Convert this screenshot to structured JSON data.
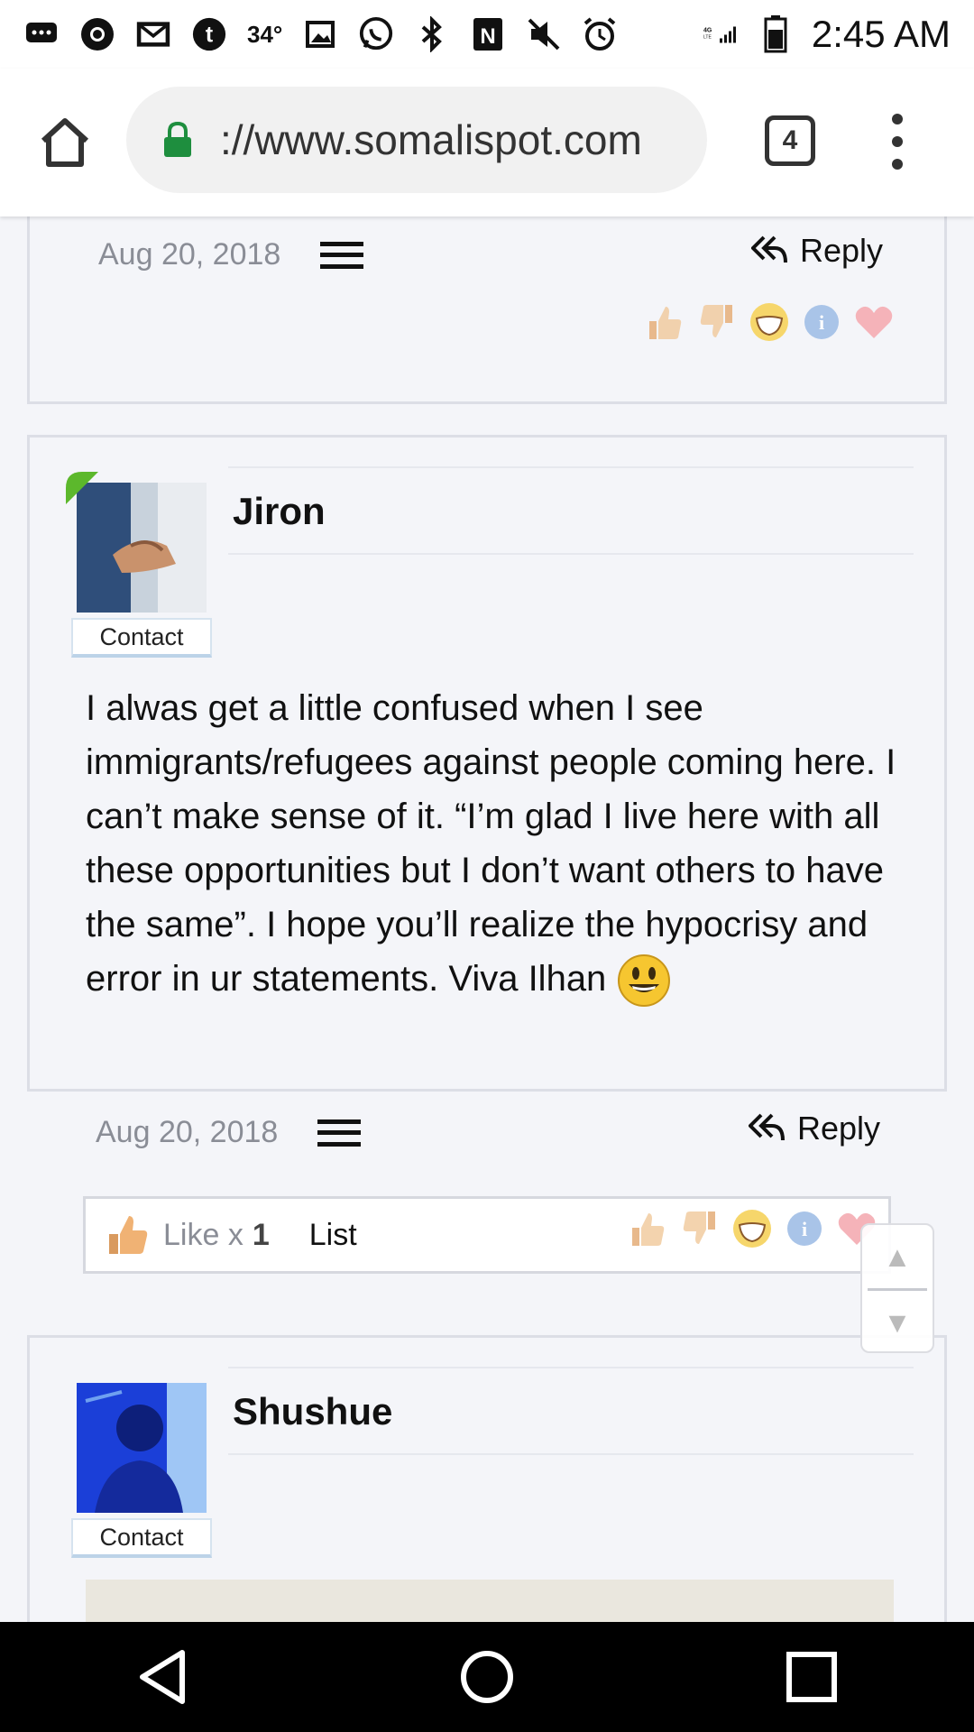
{
  "status_bar": {
    "temperature": "34°",
    "network": "4G LTE",
    "time": "2:45 AM",
    "icons": [
      "message-icon",
      "chrome-icon",
      "gmail-icon",
      "tumblr-icon",
      "gallery-icon",
      "whatsapp-icon",
      "bluetooth-icon",
      "nfc-icon",
      "mute-icon",
      "alarm-icon",
      "signal-icon",
      "battery-icon"
    ]
  },
  "browser": {
    "url": "://www.somalispot.com",
    "tab_count": "4"
  },
  "posts": [
    {
      "date": "Aug 20, 2018",
      "reply_label": "Reply"
    },
    {
      "username": "Jiron",
      "contact_label": "Contact",
      "body": "I alwas get a little confused when I see immigrants/refugees against people coming here. I can’t make sense of it. “I’m glad I live here with all these opportunities but I don’t want others to have the same”. I hope you’ll realize the hypocrisy and error in ur statements. Viva Ilhan",
      "date": "Aug 20, 2018",
      "reply_label": "Reply",
      "like_label": "Like x",
      "like_count": "1",
      "list_label": "List"
    },
    {
      "username": "Shushue",
      "contact_label": "Contact"
    }
  ],
  "scroll_controls": {
    "up": "▲",
    "down": "▼"
  },
  "colors": {
    "accent_lock": "#1e8e3e",
    "page_bg": "#f4f5f9",
    "card_border": "#dcdee6"
  }
}
